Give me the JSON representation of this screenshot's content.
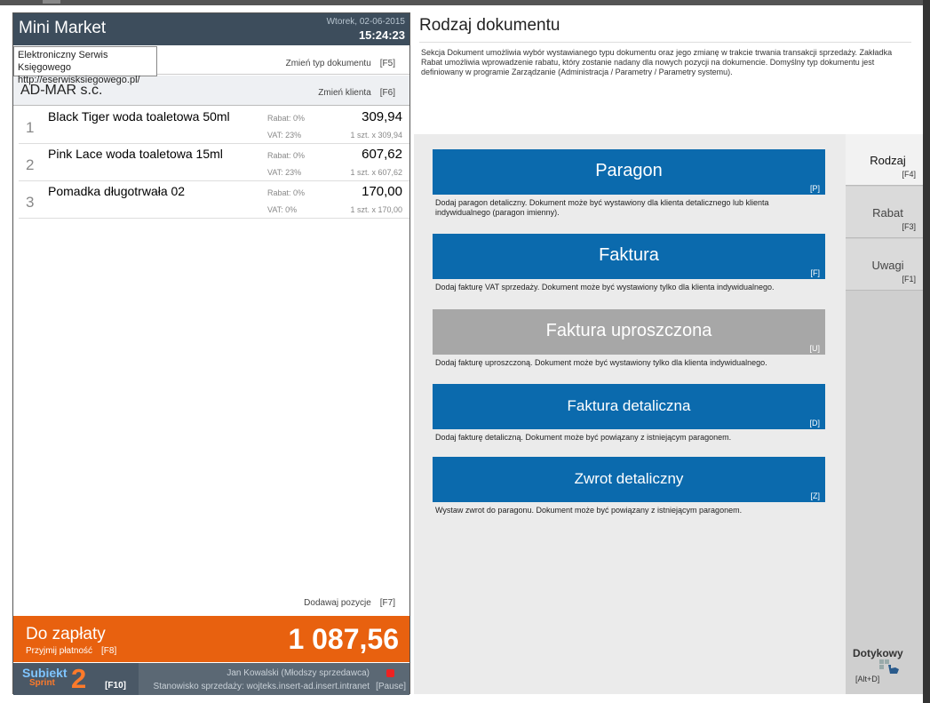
{
  "header": {
    "app_name": "Mini Market",
    "date": "Wtorek, 02-06-2015",
    "time": "15:24:23"
  },
  "tooltip": {
    "line1": "Elektroniczny Serwis Księgowego",
    "line2": "http://eserwisksiegowego.pl/"
  },
  "document": {
    "change_label": "Zmień typ dokumentu",
    "change_key": "[F5]"
  },
  "client": {
    "name": "AD-MAR s.c.",
    "change_label": "Zmień klienta",
    "change_key": "[F6]"
  },
  "items": [
    {
      "num": "1",
      "name": "Black Tiger woda toaletowa 50ml",
      "rabat": "Rabat:  0%",
      "vat": "VAT:  23%",
      "price": "309,94",
      "qty": "1 szt. x 309,94"
    },
    {
      "num": "2",
      "name": "Pink Lace woda toaletowa 15ml",
      "rabat": "Rabat:  0%",
      "vat": "VAT:  23%",
      "price": "607,62",
      "qty": "1 szt. x 607,62"
    },
    {
      "num": "3",
      "name": "Pomadka długotrwała 02",
      "rabat": "Rabat:  0%",
      "vat": "VAT:  0%",
      "price": "170,00",
      "qty": "1 szt. x 170,00"
    }
  ],
  "add_position": {
    "label": "Dodawaj pozycje",
    "key": "[F7]"
  },
  "payment": {
    "label": "Do zapłaty",
    "accept": "Przyjmij płatność",
    "accept_key": "[F8]",
    "amount": "1 087,56"
  },
  "logo": {
    "line1": "Subiekt",
    "line2": "Sprint",
    "digit": "2",
    "key": "[F10]"
  },
  "footer": {
    "user": "Jan Kowalski (Młodszy sprzedawca)",
    "station": "Stanowisko sprzedaży: wojteks.insert-ad.insert.intranet",
    "pause": "[Pause]"
  },
  "right": {
    "title": "Rodzaj dokumentu",
    "description": "Sekcja Dokument umożliwia wybór wystawianego typu dokumentu oraz jego zmianę w trakcie trwania transakcji sprzedaży. Zakładka Rabat umożliwia wprowadzenie rabatu, który zostanie nadany dla nowych pozycji na dokumencie. Domyślny typ dokumentu jest definiowany w programie Zarządzanie (Administracja / Parametry / Parametry systemu)."
  },
  "doc_types": [
    {
      "label": "Paragon",
      "key": "[P]",
      "desc": "Dodaj paragon detaliczny. Dokument może być wystawiony dla klienta detalicznego lub klienta indywidualnego (paragon imienny)."
    },
    {
      "label": "Faktura",
      "key": "[F]",
      "desc": "Dodaj fakturę VAT sprzedaży. Dokument może być wystawiony tylko dla klienta indywidualnego."
    },
    {
      "label": "Faktura uproszczona",
      "key": "[U]",
      "desc": "Dodaj fakturę uproszczoną. Dokument może być wystawiony tylko dla klienta indywidualnego."
    },
    {
      "label": "Faktura detaliczna",
      "key": "[D]",
      "desc": "Dodaj fakturę detaliczną. Dokument może być powiązany z istniejącym paragonem."
    },
    {
      "label": "Zwrot detaliczny",
      "key": "[Z]",
      "desc": "Wystaw zwrot do paragonu. Dokument może być powiązany z istniejącym paragonem."
    }
  ],
  "tabs": [
    {
      "label": "Rodzaj",
      "key": "[F4]"
    },
    {
      "label": "Rabat",
      "key": "[F3]"
    },
    {
      "label": "Uwagi",
      "key": "[F1]"
    }
  ],
  "touch": {
    "label": "Dotykowy",
    "key": "[Alt+D]"
  },
  "colors": {
    "header": "#3d4d5c",
    "payment": "#e8610f",
    "doc_button": "#0b6aad",
    "doc_button_disabled": "#a7a7a7"
  }
}
